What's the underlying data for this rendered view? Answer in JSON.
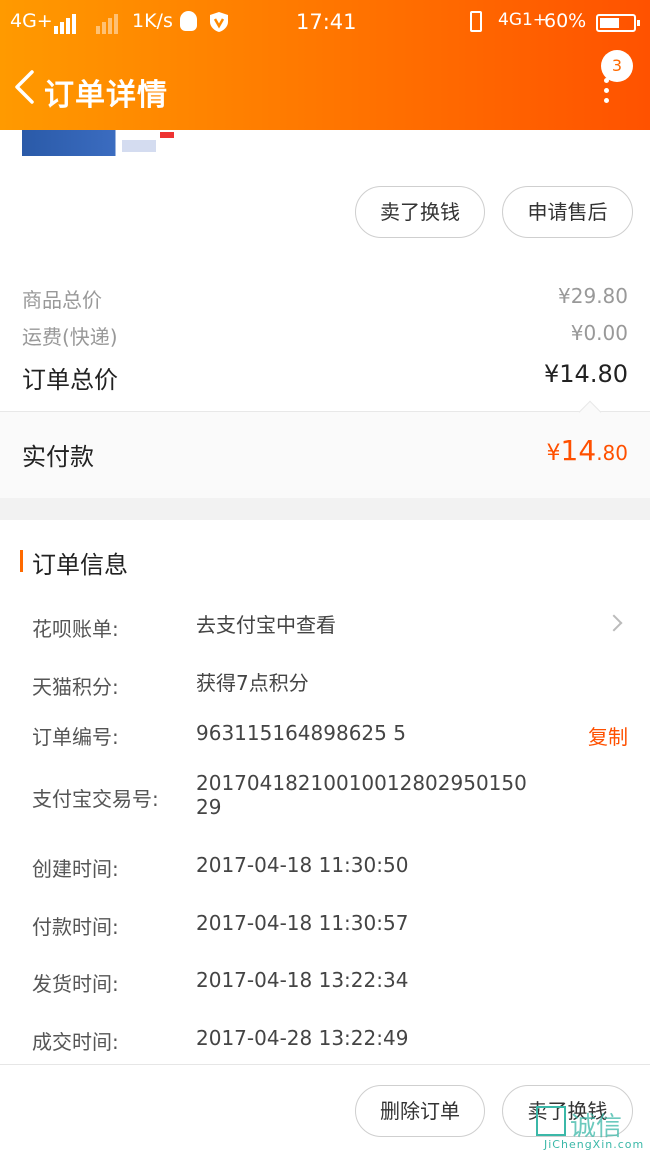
{
  "status_bar": {
    "net_left": "4G+",
    "speed": "1K/s",
    "time": "17:41",
    "net_right": "4G1+",
    "battery_pct": "60%",
    "battery_level": 0.6
  },
  "header": {
    "title": "订单详情",
    "badge_count": "3",
    "color_start": "#ff9a00",
    "color_end": "#ff5200"
  },
  "product_actions": {
    "sell_exchange": "卖了换钱",
    "after_sales": "申请售后"
  },
  "prices": {
    "goods_total_label": "商品总价",
    "goods_total": "¥29.80",
    "shipping_label": "运费(快递)",
    "shipping": "¥0.00",
    "order_total_label": "订单总价",
    "order_total": "¥14.80",
    "paid_label": "实付款",
    "paid_currency": "¥",
    "paid_int": "14",
    "paid_dec": ".80"
  },
  "order_info": {
    "title": "订单信息",
    "rows": [
      {
        "key": "花呗账单:",
        "value": "去支付宝中查看"
      },
      {
        "key": "天猫积分:",
        "value": "获得7点积分"
      },
      {
        "key": "订单编号:",
        "value": "963115164898625 5",
        "copy": "复制"
      },
      {
        "key": "支付宝交易号:",
        "value": "20170418210010012802950150 29"
      },
      {
        "key": "创建时间:",
        "value": "2017-04-18 11:30:50"
      },
      {
        "key": "付款时间:",
        "value": "2017-04-18 11:30:57"
      },
      {
        "key": "发货时间:",
        "value": "2017-04-18 13:22:34"
      },
      {
        "key": "成交时间:",
        "value": "2017-04-28 13:22:49"
      }
    ]
  },
  "footer": {
    "delete_order": "删除订单",
    "sell_exchange": "卖了换钱"
  },
  "watermark": {
    "text": "诚信",
    "url": "JiChengXin.com"
  },
  "colors": {
    "accent": "#ff5000",
    "bar": "#ff6a00"
  }
}
